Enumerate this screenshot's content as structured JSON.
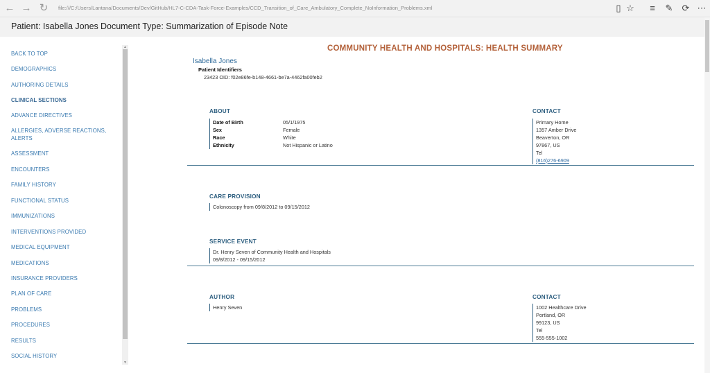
{
  "browser": {
    "url": "file:///C:/Users/Lantana/Documents/Dev/GitHub/HL7-C-CDA-Task-Force-Examples/CCD_Transition_of_Care_Ambulatory_Complete_NoInformation_Problems.xml"
  },
  "header": {
    "patient": "Patient: Isabella Jones",
    "doc_type": "Document Type: Summarization of Episode Note"
  },
  "sidebar": {
    "items": [
      {
        "label": "BACK TO TOP"
      },
      {
        "label": "DEMOGRAPHICS"
      },
      {
        "label": "AUTHORING DETAILS"
      },
      {
        "label": "CLINICAL SECTIONS"
      },
      {
        "label": "ADVANCE DIRECTIVES"
      },
      {
        "label": "ALLERGIES, ADVERSE REACTIONS, ALERTS"
      },
      {
        "label": "ASSESSMENT"
      },
      {
        "label": "ENCOUNTERS"
      },
      {
        "label": "FAMILY HISTORY"
      },
      {
        "label": "FUNCTIONAL STATUS"
      },
      {
        "label": "IMMUNIZATIONS"
      },
      {
        "label": "INTERVENTIONS PROVIDED"
      },
      {
        "label": "MEDICAL EQUIPMENT"
      },
      {
        "label": "MEDICATIONS"
      },
      {
        "label": "INSURANCE PROVIDERS"
      },
      {
        "label": "PLAN OF CARE"
      },
      {
        "label": "PROBLEMS"
      },
      {
        "label": "PROCEDURES"
      },
      {
        "label": "RESULTS"
      },
      {
        "label": "SOCIAL HISTORY"
      }
    ]
  },
  "doc": {
    "title": "COMMUNITY HEALTH AND HOSPITALS: HEALTH SUMMARY",
    "patient_name": "Isabella Jones",
    "patient_identifiers_label": "Patient Identifiers",
    "patient_identifiers_value": "23423 OID: f02e86fe-b148-4661-be7a-4462fa00feb2",
    "about": {
      "heading": "ABOUT",
      "rows": [
        {
          "k": "Date of Birth",
          "v": "05/1/1975"
        },
        {
          "k": "Sex",
          "v": "Female"
        },
        {
          "k": "Race",
          "v": "White"
        },
        {
          "k": "Ethnicity",
          "v": "Not Hispanic or Latino"
        }
      ]
    },
    "contact1": {
      "heading": "CONTACT",
      "lines": [
        "Primary Home",
        "1357 Amber Drive",
        "Beaverton, OR",
        "97867, US",
        "Tel"
      ],
      "phone": "(816)276-6909"
    },
    "care_provision": {
      "heading": "CARE PROVISION",
      "text": "Colonoscopy from 09/8/2012 to 09/15/2012"
    },
    "service_event": {
      "heading": "SERVICE EVENT",
      "lines": [
        "Dr. Henry Seven of Community Health and Hospitals",
        "09/8/2012 - 09/15/2012"
      ]
    },
    "author": {
      "heading": "AUTHOR",
      "text": "Henry Seven"
    },
    "contact2": {
      "heading": "CONTACT",
      "lines": [
        "1002 Healthcare Drive",
        "Portland, OR",
        "99123, US",
        "Tel",
        "555-555-1002"
      ]
    }
  }
}
